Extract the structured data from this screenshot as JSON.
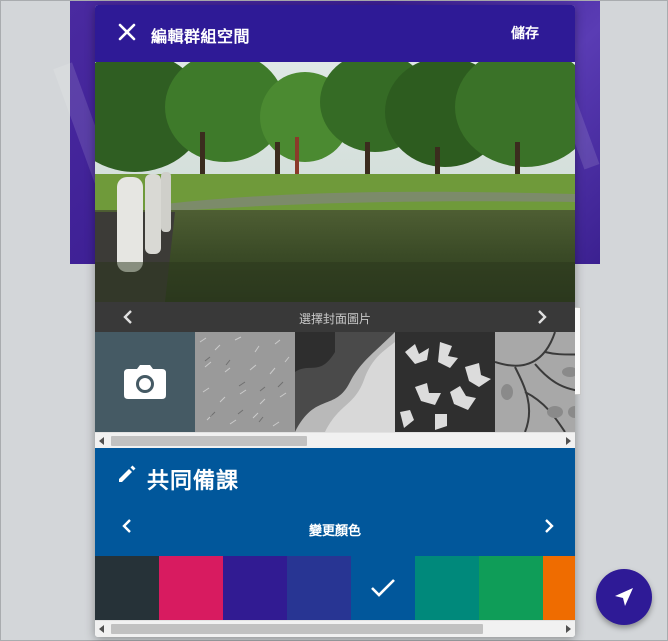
{
  "header": {
    "title": "編輯群組空間",
    "save_label": "儲存",
    "close_icon": "close-icon"
  },
  "cover": {
    "label": "選擇封面圖片",
    "prev_icon": "chevron-left-icon",
    "next_icon": "chevron-right-icon",
    "upload_icon": "camera-icon",
    "thumbnails": [
      "grass-texture",
      "smooth-fabric",
      "frost-crystals",
      "leaf-veins"
    ]
  },
  "group": {
    "name": "共同備課",
    "edit_icon": "pencil-icon"
  },
  "color": {
    "label": "變更顏色",
    "selected_index": 4,
    "swatches": [
      "#263238",
      "#d81b60",
      "#311b92",
      "#283593",
      "#01579b",
      "#00897b",
      "#0f9d58",
      "#ef6c00"
    ]
  },
  "fab": {
    "icon": "send-icon"
  },
  "colors": {
    "header": "#2e1a96",
    "section": "#01579b",
    "camera_tile": "#455a64"
  }
}
